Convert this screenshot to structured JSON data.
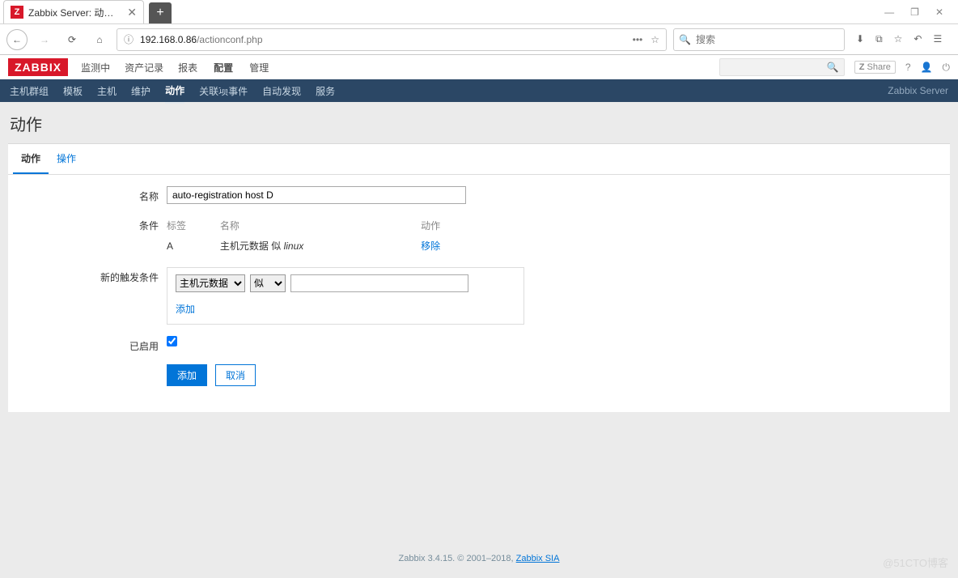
{
  "browser": {
    "tab_title": "Zabbix Server: 动作的配置",
    "favicon_letter": "Z",
    "url_host": "192.168.0.86",
    "url_path": "/actionconf.php",
    "search_placeholder": "搜索"
  },
  "win_controls": {
    "min": "—",
    "max": "❐",
    "close": "✕"
  },
  "header": {
    "logo": "ZABBIX",
    "menu": [
      "监测中",
      "资产记录",
      "报表",
      "配置",
      "管理"
    ],
    "active_menu_index": 3,
    "share_label": "Share"
  },
  "submenu": {
    "items": [
      "主机群组",
      "模板",
      "主机",
      "维护",
      "动作",
      "关联项事件",
      "自动发现",
      "服务"
    ],
    "active_index": 4,
    "right_text": "Zabbix Server"
  },
  "page": {
    "title": "动作",
    "tabs": [
      "动作",
      "操作"
    ],
    "active_tab_index": 0
  },
  "form": {
    "name_label": "名称",
    "name_value": "auto-registration host D",
    "conditions_label": "条件",
    "th_tag": "标签",
    "th_name": "名称",
    "th_action": "动作",
    "row_tag": "A",
    "row_name_a": "主机元数据 似 ",
    "row_name_b": "linux",
    "row_remove": "移除",
    "new_cond_label": "新的触发条件",
    "sel1": "主机元数据",
    "sel2": "似",
    "add_link": "添加",
    "enabled_label": "已启用",
    "enabled_checked": true,
    "btn_add": "添加",
    "btn_cancel": "取消"
  },
  "footer": {
    "text_a": "Zabbix 3.4.15. © 2001–2018, ",
    "link": "Zabbix SIA"
  },
  "watermark": "@51CTO博客"
}
